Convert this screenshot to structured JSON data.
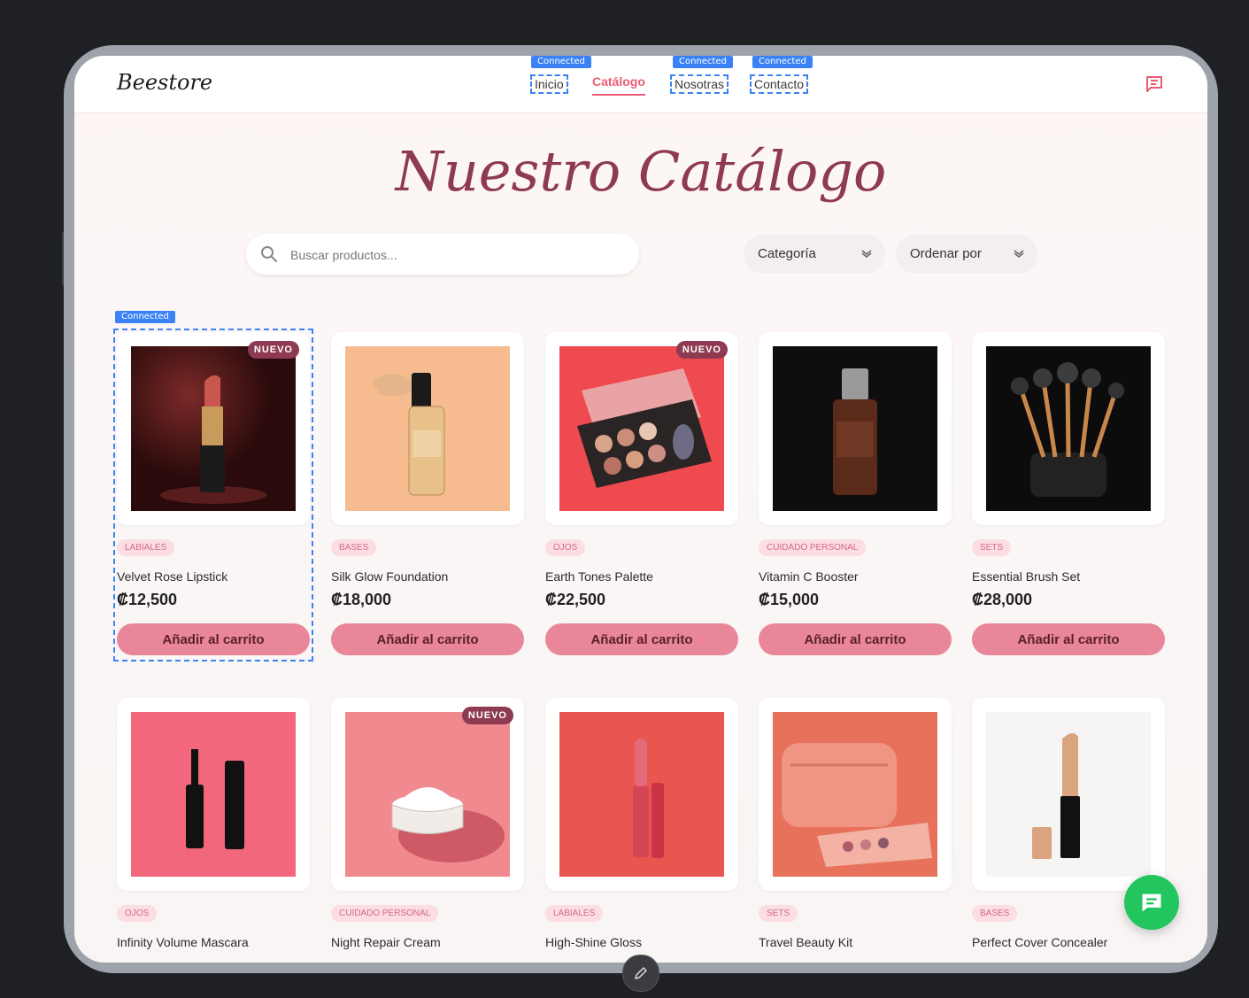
{
  "app": {
    "title": "Beestore"
  },
  "nav": {
    "items": [
      {
        "label": "Inicio",
        "connected": "Connected"
      },
      {
        "label": "Catálogo"
      },
      {
        "label": "Nosotras",
        "connected": "Connected"
      },
      {
        "label": "Contacto",
        "connected": "Connected"
      }
    ]
  },
  "page": {
    "title": "Nuestro Catálogo"
  },
  "search": {
    "placeholder": "Buscar productos...",
    "value": ""
  },
  "filters": {
    "category": "Categoría",
    "sort": "Ordenar por"
  },
  "selection_badge": "Connected",
  "add_to_cart_label": "Añadir al carrito",
  "new_badge": "NUEVO",
  "products": [
    {
      "category": "Labiales",
      "name": "Velvet Rose Lipstick",
      "price": "₡12,500",
      "new": true,
      "icon": "lipstick-image"
    },
    {
      "category": "Bases",
      "name": "Silk Glow Foundation",
      "price": "₡18,000",
      "new": false,
      "icon": "foundation-bottle-image"
    },
    {
      "category": "Ojos",
      "name": "Earth Tones Palette",
      "price": "₡22,500",
      "new": true,
      "icon": "eyeshadow-palette-image"
    },
    {
      "category": "Cuidado Personal",
      "name": "Vitamin C Booster",
      "price": "₡15,000",
      "new": false,
      "icon": "serum-bottle-image"
    },
    {
      "category": "Sets",
      "name": "Essential Brush Set",
      "price": "₡28,000",
      "new": false,
      "icon": "brush-set-image"
    },
    {
      "category": "Ojos",
      "name": "Infinity Volume Mascara",
      "price": "",
      "new": false,
      "icon": "mascara-image"
    },
    {
      "category": "Cuidado Personal",
      "name": "Night Repair Cream",
      "price": "",
      "new": true,
      "icon": "cream-jar-image"
    },
    {
      "category": "Labiales",
      "name": "High-Shine Gloss",
      "price": "",
      "new": false,
      "icon": "lip-gloss-image"
    },
    {
      "category": "Sets",
      "name": "Travel Beauty Kit",
      "price": "",
      "new": false,
      "icon": "travel-kit-image"
    },
    {
      "category": "Bases",
      "name": "Perfect Cover Concealer",
      "price": "",
      "new": false,
      "icon": "concealer-image"
    }
  ],
  "colors": {
    "accent": "#e85d75",
    "title": "#8e3a52",
    "button": "#e9869a",
    "fab": "#22c55e",
    "selection": "#3b82f6"
  }
}
